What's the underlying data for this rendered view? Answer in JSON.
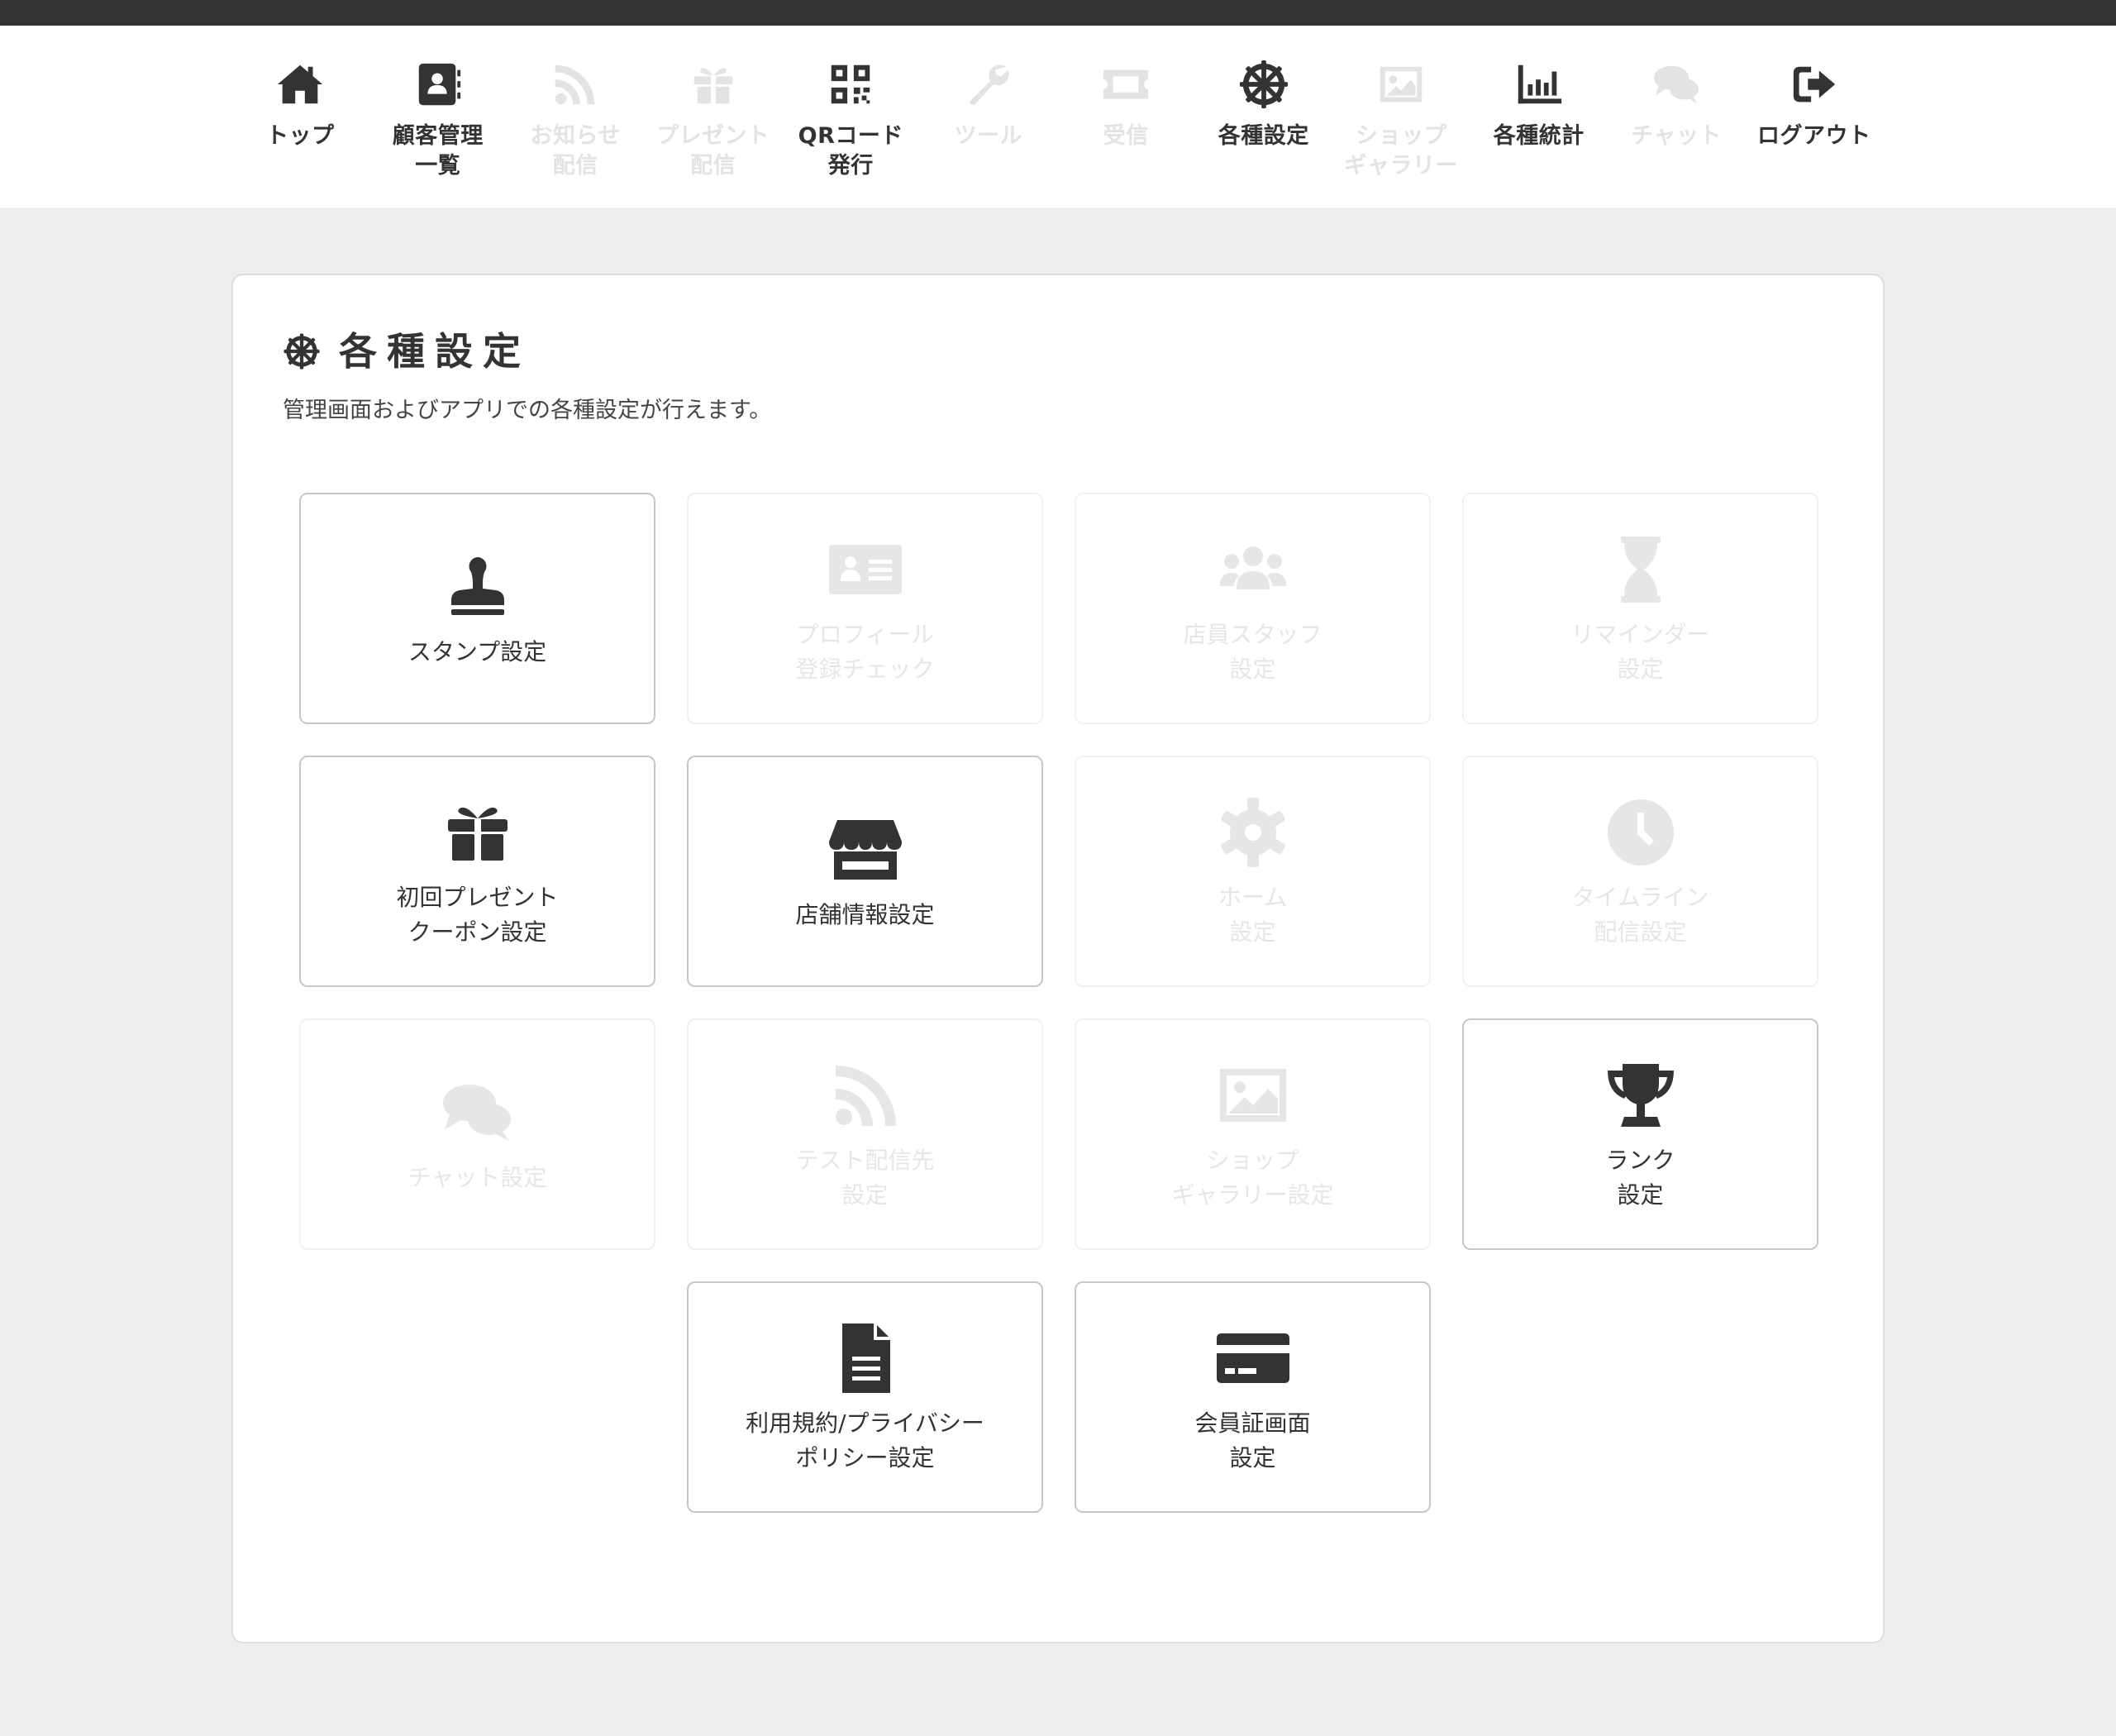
{
  "nav": {
    "items": [
      {
        "label": "トップ",
        "icon": "home-icon",
        "enabled": true
      },
      {
        "label": "顧客管理\n一覧",
        "icon": "address-book-icon",
        "enabled": true
      },
      {
        "label": "お知らせ\n配信",
        "icon": "rss-icon",
        "enabled": false
      },
      {
        "label": "プレゼント\n配信",
        "icon": "gift-icon",
        "enabled": false
      },
      {
        "label": "QRコード\n発行",
        "icon": "qrcode-icon",
        "enabled": true
      },
      {
        "label": "ツール",
        "icon": "wrench-icon",
        "enabled": false
      },
      {
        "label": "受信",
        "icon": "ticket-icon",
        "enabled": false
      },
      {
        "label": "各種設定",
        "icon": "helm-icon",
        "enabled": true
      },
      {
        "label": "ショップ\nギャラリー",
        "icon": "image-icon",
        "enabled": false
      },
      {
        "label": "各種統計",
        "icon": "bar-chart-icon",
        "enabled": true
      },
      {
        "label": "チャット",
        "icon": "comments-icon",
        "enabled": false
      },
      {
        "label": "ログアウト",
        "icon": "sign-out-icon",
        "enabled": true
      }
    ]
  },
  "page": {
    "title": "各種設定",
    "title_icon": "helm-icon",
    "description": "管理画面およびアプリでの各種設定が行えます。"
  },
  "tiles": [
    {
      "label": "スタンプ設定",
      "icon": "stamp-icon",
      "enabled": true
    },
    {
      "label": "プロフィール\n登録チェック",
      "icon": "id-card-icon",
      "enabled": false
    },
    {
      "label": "店員スタッフ\n設定",
      "icon": "users-icon",
      "enabled": false
    },
    {
      "label": "リマインダー\n設定",
      "icon": "hourglass-icon",
      "enabled": false
    },
    {
      "label": "初回プレゼント\nクーポン設定",
      "icon": "gift-icon",
      "enabled": true
    },
    {
      "label": "店舗情報設定",
      "icon": "store-icon",
      "enabled": true
    },
    {
      "label": "ホーム\n設定",
      "icon": "cog-icon",
      "enabled": false
    },
    {
      "label": "タイムライン\n配信設定",
      "icon": "clock-icon",
      "enabled": false
    },
    {
      "label": "チャット設定",
      "icon": "comments-icon",
      "enabled": false
    },
    {
      "label": "テスト配信先\n設定",
      "icon": "rss-icon",
      "enabled": false
    },
    {
      "label": "ショップ\nギャラリー設定",
      "icon": "image-icon",
      "enabled": false
    },
    {
      "label": "ランク\n設定",
      "icon": "trophy-icon",
      "enabled": true
    },
    {
      "label": "利用規約/プライバシー\nポリシー設定",
      "icon": "file-text-icon",
      "enabled": true
    },
    {
      "label": "会員証画面\n設定",
      "icon": "credit-card-icon",
      "enabled": true
    }
  ],
  "colors": {
    "active_text": "#333333",
    "disabled_text": "#e3e3e3",
    "page_background": "#eeeeee",
    "top_strip": "#333333"
  }
}
